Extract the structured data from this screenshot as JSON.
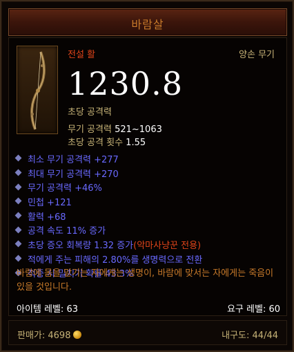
{
  "item": {
    "name": "바람살",
    "rarity": "전설 활",
    "slot_type": "양손 무기",
    "dps": "1230.8",
    "dps_label": "초당 공격력"
  },
  "base_stats": [
    {
      "label": "무기 공격력 ",
      "value": "521~1063"
    },
    {
      "label": "초당 공격 횟수 ",
      "value": "1.55"
    }
  ],
  "affixes": [
    {
      "text": "최소 무기 공격력 +277",
      "note": ""
    },
    {
      "text": "최대 무기 공격력 +270",
      "note": ""
    },
    {
      "text": "무기 공격력 +46%",
      "note": ""
    },
    {
      "text": "민첩 +121",
      "note": ""
    },
    {
      "text": "활력 +68",
      "note": ""
    },
    {
      "text": "공격 속도 11% 증가",
      "note": ""
    },
    {
      "text": "초당 증오 회복량 1.32 증가 ",
      "note": "(악마사냥꾼 전용)"
    },
    {
      "text": "적에게 주는 피해의 2.80%를 생명력으로 전환",
      "note": ""
    },
    {
      "text": "적중 시 밀치기 확률 43.3%",
      "note": ""
    }
  ],
  "flavor_text": "바람에 몸을 맡기는 자에게는 생명이, 바람에 맞서는 자에게는 죽음이 있을 것입니다.",
  "requirements": {
    "item_level": "아이템 레벨: 63",
    "required_level": "요구 레벨: 60"
  },
  "footer": {
    "sell_price": "판매가: 4698",
    "durability": "내구도: 44/44"
  },
  "colors": {
    "legendary": "#c87a2a",
    "magic_affix": "#6969ff",
    "class_restriction": "#e0441a"
  },
  "icons": {
    "item": "bow-icon",
    "bullet": "diamond-bullet-icon",
    "gold": "gold-coin-icon"
  }
}
